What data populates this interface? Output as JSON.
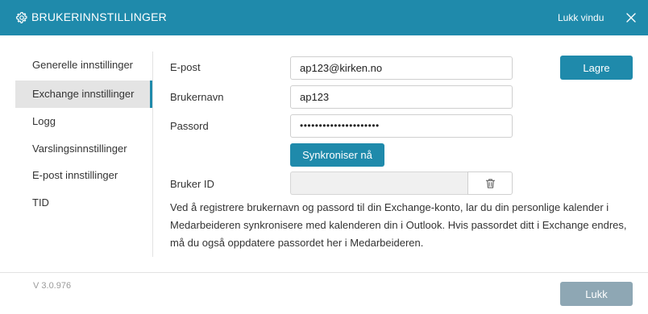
{
  "window": {
    "title": "BRUKERINNSTILLINGER",
    "close_label": "Lukk vindu",
    "title_icon": "gear-icon",
    "close_icon": "close-icon"
  },
  "sidebar": {
    "items": [
      {
        "label": "Generelle innstillinger",
        "active": false
      },
      {
        "label": "Exchange innstillinger",
        "active": true
      },
      {
        "label": "Logg",
        "active": false
      },
      {
        "label": "Varslingsinnstillinger",
        "active": false
      },
      {
        "label": "E-post innstillinger",
        "active": false
      },
      {
        "label": "TID",
        "active": false
      }
    ]
  },
  "form": {
    "email_label": "E-post",
    "email_value": "ap123@kirken.no",
    "username_label": "Brukernavn",
    "username_value": "ap123",
    "password_label": "Passord",
    "password_value": "•••••••••••••••••••••",
    "sync_button": "Synkroniser nå",
    "userid_label": "Bruker ID",
    "userid_value": "",
    "trash_icon": "trash-icon",
    "info_text": "Ved å registrere brukernavn og passord til din Exchange-konto, lar du din personlige kalender i Medarbeideren synkronisere med kalenderen din i Outlook. Hvis passordet ditt i Exchange endres, må du også oppdatere passordet her i Medarbeideren."
  },
  "actions": {
    "save_label": "Lagre",
    "close_label": "Lukk"
  },
  "footer": {
    "version": "V 3.0.976"
  },
  "colors": {
    "accent": "#1f8aab",
    "disabled_button": "#8ea7b4",
    "active_nav_bg": "#e4e4e4"
  }
}
